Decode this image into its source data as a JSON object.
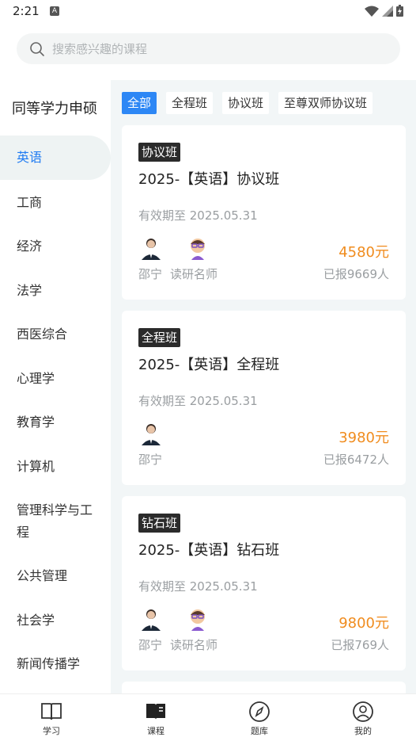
{
  "status_bar": {
    "time": "2:21",
    "notif_letter": "A"
  },
  "search": {
    "placeholder": "搜索感兴趣的课程"
  },
  "sidebar": {
    "title": "同等学力申硕",
    "items": [
      {
        "label": "英语",
        "active": true
      },
      {
        "label": "工商"
      },
      {
        "label": "经济"
      },
      {
        "label": "法学"
      },
      {
        "label": "西医综合"
      },
      {
        "label": "心理学"
      },
      {
        "label": "教育学"
      },
      {
        "label": "计算机"
      },
      {
        "label": "管理科学与工程"
      },
      {
        "label": "公共管理"
      },
      {
        "label": "社会学"
      },
      {
        "label": "新闻传播学"
      }
    ]
  },
  "filters": [
    "全部",
    "全程班",
    "协议班",
    "至尊双师协议班"
  ],
  "cards": [
    {
      "tag": "协议班",
      "title": "2025-【英语】协议班",
      "valid": "有效期至 2025.05.31",
      "teachers": [
        "邵宁",
        "读研名师"
      ],
      "price": "4580元",
      "enrolled": "已报9669人"
    },
    {
      "tag": "全程班",
      "title": "2025-【英语】全程班",
      "valid": "有效期至 2025.05.31",
      "teachers": [
        "邵宁"
      ],
      "price": "3980元",
      "enrolled": "已报6472人"
    },
    {
      "tag": "钻石班",
      "title": "2025-【英语】钻石班",
      "valid": "有效期至 2025.05.31",
      "teachers": [
        "邵宁",
        "读研名师"
      ],
      "price": "9800元",
      "enrolled": "已报769人"
    }
  ],
  "bottom_nav": [
    {
      "label": "学习",
      "icon": "book-open-icon"
    },
    {
      "label": "课程",
      "icon": "book-filled-icon"
    },
    {
      "label": "题库",
      "icon": "compass-icon"
    },
    {
      "label": "我的",
      "icon": "user-icon"
    }
  ],
  "colors": {
    "accent": "#2d87f5",
    "price": "#f08c1e",
    "panel_bg": "#f2f6f7"
  }
}
